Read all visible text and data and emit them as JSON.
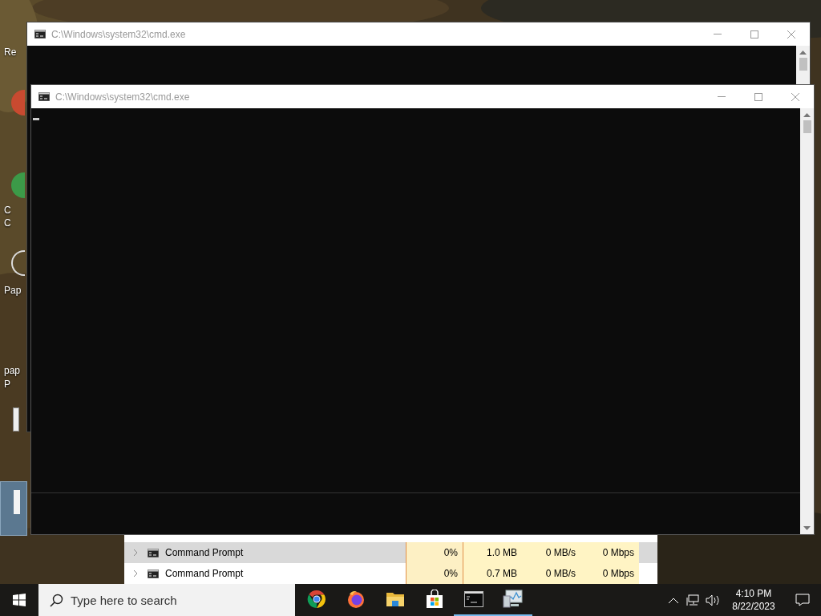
{
  "desktop_labels": [
    "Re",
    "C",
    "C",
    "Pap",
    "pap",
    "P"
  ],
  "background_window": {
    "title": "C:\\Windows\\system32\\cmd.exe"
  },
  "foreground_window": {
    "title": "C:\\Windows\\system32\\cmd.exe"
  },
  "task_manager": {
    "rows": [
      {
        "name": "Command Prompt",
        "cpu": "0%",
        "memory": "1.0 MB",
        "disk": "0 MB/s",
        "network": "0 Mbps",
        "selected": true
      },
      {
        "name": "Command Prompt",
        "cpu": "0%",
        "memory": "0.7 MB",
        "disk": "0 MB/s",
        "network": "0 Mbps",
        "selected": false
      }
    ]
  },
  "taskbar": {
    "search": {
      "placeholder": "Type here to search"
    },
    "apps": [
      {
        "kind": "chrome",
        "running": false
      },
      {
        "kind": "firefox",
        "running": false
      },
      {
        "kind": "explorer",
        "running": false
      },
      {
        "kind": "store",
        "running": false
      },
      {
        "kind": "terminal",
        "running": true
      },
      {
        "kind": "monitor",
        "running": true
      }
    ],
    "time": "4:10 PM",
    "date": "8/22/2023"
  }
}
